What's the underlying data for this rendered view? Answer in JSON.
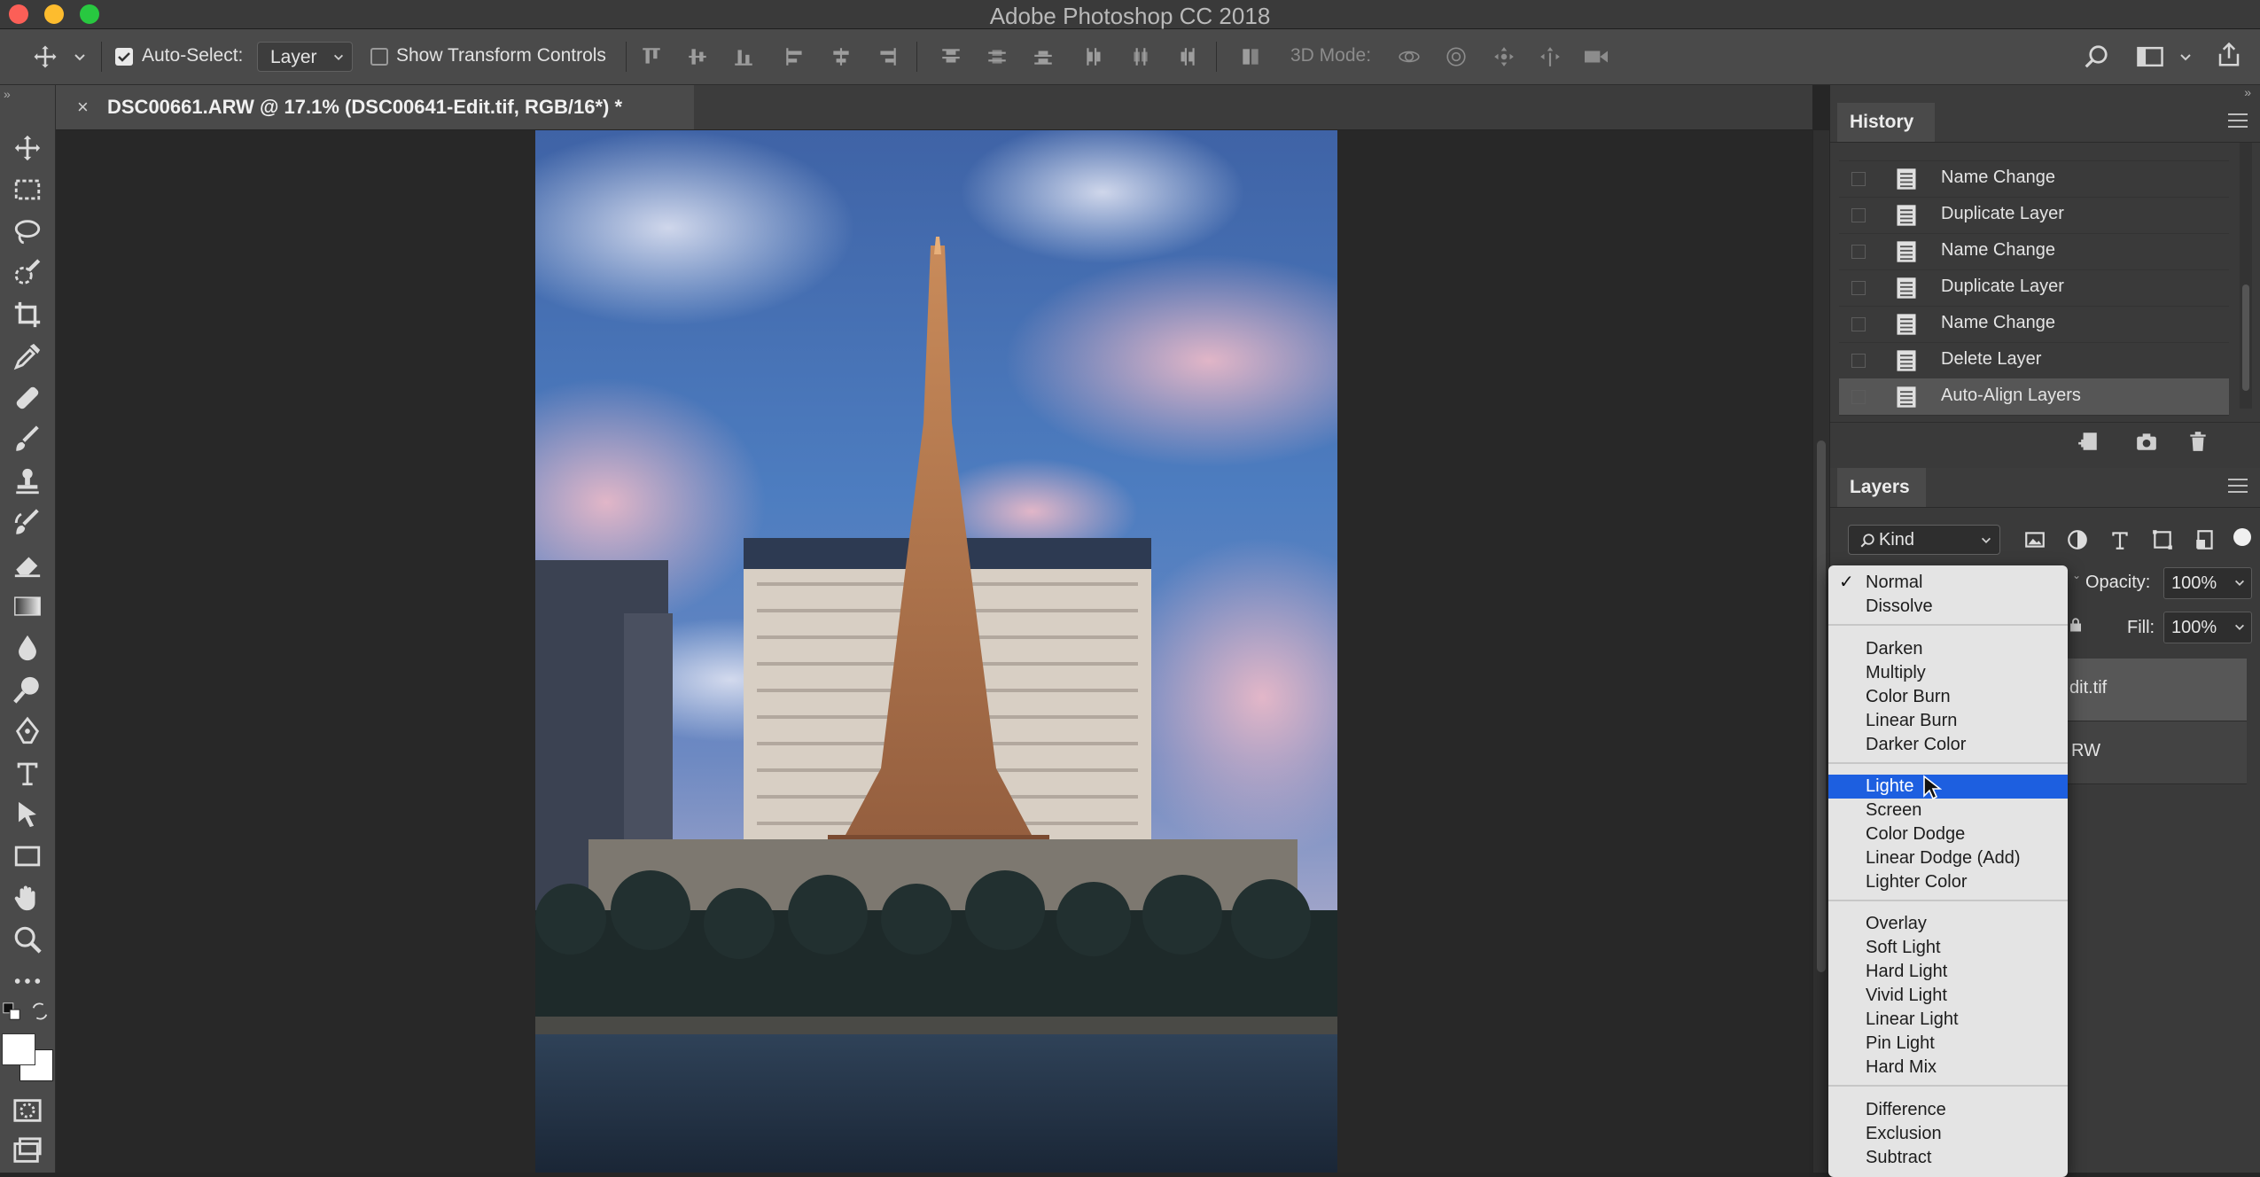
{
  "window": {
    "title": "Adobe Photoshop CC 2018",
    "traffic_colors": {
      "close": "#fc5f57",
      "minimize": "#fdbc2e",
      "maximize": "#28c840"
    }
  },
  "options_bar": {
    "auto_select_label": "Auto-Select:",
    "auto_select_checked": true,
    "auto_select_target": "Layer",
    "show_transform_label": "Show Transform Controls",
    "show_transform_checked": false,
    "mode_3d_label": "3D Mode:"
  },
  "document": {
    "tab_title": "DSC00661.ARW @ 17.1% (DSC00641-Edit.tif, RGB/16*) *",
    "close_glyph": "×"
  },
  "history": {
    "title": "History",
    "items": [
      {
        "label": "Name Change"
      },
      {
        "label": "Duplicate Layer"
      },
      {
        "label": "Name Change"
      },
      {
        "label": "Duplicate Layer"
      },
      {
        "label": "Name Change"
      },
      {
        "label": "Delete Layer"
      },
      {
        "label": "Auto-Align Layers"
      }
    ]
  },
  "layers": {
    "title": "Layers",
    "kind_label": "Kind",
    "opacity_label": "Opacity:",
    "opacity_value": "100%",
    "fill_label": "Fill:",
    "fill_value": "100%",
    "layer_items": [
      {
        "name_fragment": "dit.tif"
      },
      {
        "name_fragment": "RW"
      }
    ]
  },
  "blend_modes": {
    "checked": "Normal",
    "highlighted": "Lighten",
    "highlighted_visible_text": "Lighte",
    "groups": [
      [
        "Normal",
        "Dissolve"
      ],
      [
        "Darken",
        "Multiply",
        "Color Burn",
        "Linear Burn",
        "Darker Color"
      ],
      [
        "Lighten",
        "Screen",
        "Color Dodge",
        "Linear Dodge (Add)",
        "Lighter Color"
      ],
      [
        "Overlay",
        "Soft Light",
        "Hard Light",
        "Vivid Light",
        "Linear Light",
        "Pin Light",
        "Hard Mix"
      ],
      [
        "Difference",
        "Exclusion",
        "Subtract"
      ]
    ]
  },
  "colors": {
    "accent_selection": "#1d5fe0",
    "panel_bg": "#3a3a3a",
    "toolbar_bg": "#4a4a4a"
  }
}
